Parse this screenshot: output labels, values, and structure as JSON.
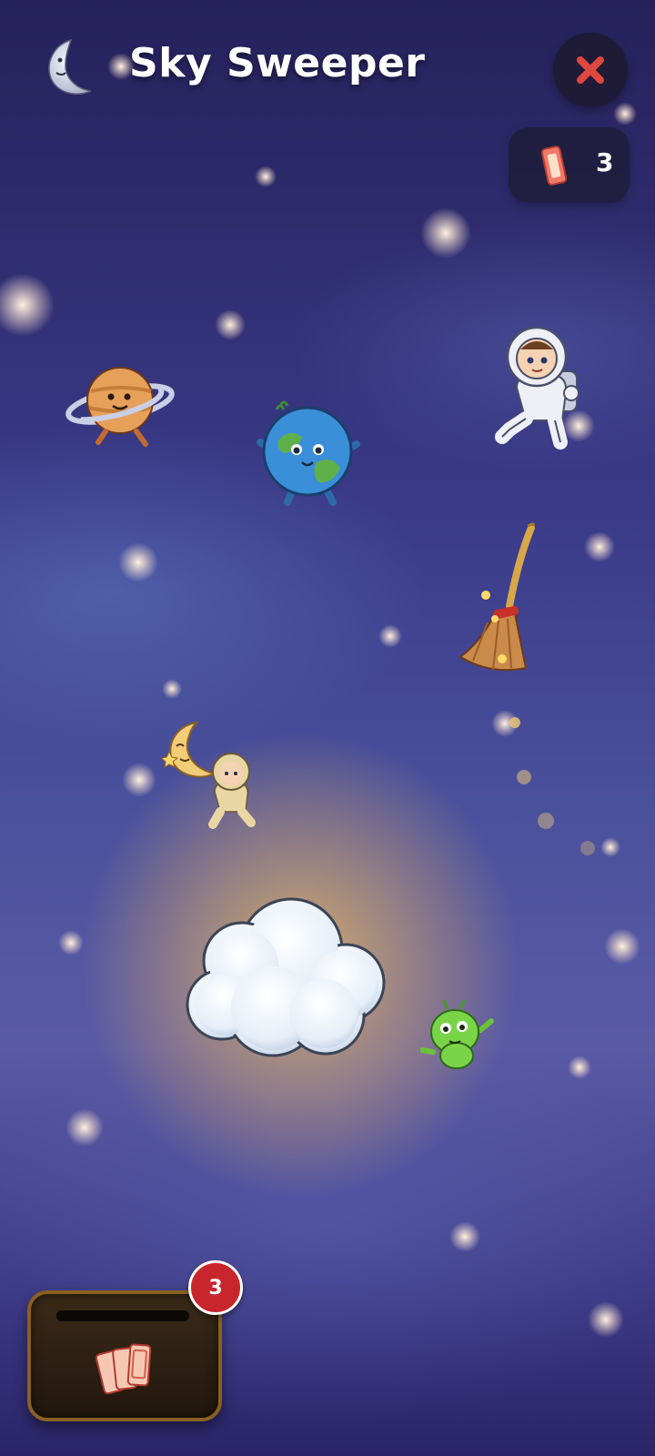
{
  "header": {
    "title": "Sky Sweeper",
    "logo_icon": "crescent-moon-face-icon",
    "close_icon": "close-x-icon"
  },
  "ticket_counter": {
    "icon": "ticket-icon",
    "count": "3"
  },
  "scene": {
    "sprites": [
      "ringed-planet-character",
      "earth-character",
      "astronaut-character",
      "magic-broom",
      "crescent-moon-character",
      "small-astronaut-character",
      "cloud",
      "green-alien-character"
    ]
  },
  "ticket_tray": {
    "icon": "tickets-stack-icon",
    "badge_count": "3"
  },
  "colors": {
    "close_x": "#e0473d",
    "badge": "#c8262d",
    "tray_border": "#8a6020",
    "ticket": "#f07a6a"
  }
}
